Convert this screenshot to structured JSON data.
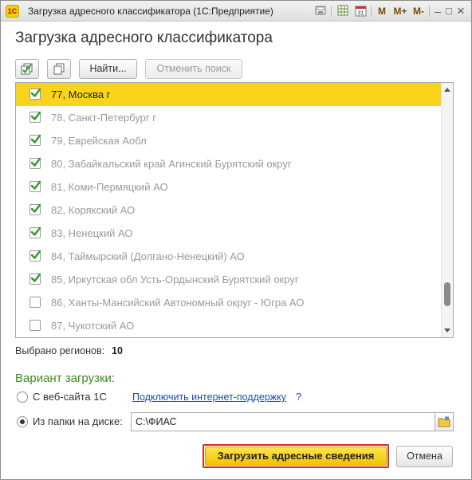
{
  "titlebar": {
    "app_logo": "1C",
    "title": "Загрузка адресного классификатора  (1С:Предприятие)",
    "icons": [
      "save-icon",
      "table-icon",
      "calendar-icon"
    ],
    "calendar_day": "31",
    "m_label": "M",
    "m_plus_label": "M+",
    "m_minus_label": "M-",
    "minimize_glyph": "–",
    "maximize_glyph": "□",
    "close_glyph": "×"
  },
  "form": {
    "title": "Загрузка адресного классификатора"
  },
  "toolbar": {
    "check_all_icon": "check-all-icon",
    "copy_icon": "copy-icon",
    "find_label": "Найти...",
    "cancel_search_label": "Отменить поиск"
  },
  "regions": [
    {
      "label": "77, Москва г",
      "checked": true,
      "selected": true
    },
    {
      "label": "78, Санкт-Петербург г",
      "checked": true,
      "selected": false
    },
    {
      "label": "79, Еврейская Аобл",
      "checked": true,
      "selected": false
    },
    {
      "label": "80, Забайкальский край Агинский Бурятский округ",
      "checked": true,
      "selected": false
    },
    {
      "label": "81, Коми-Пермяцкий АО",
      "checked": true,
      "selected": false
    },
    {
      "label": "82, Корякский АО",
      "checked": true,
      "selected": false
    },
    {
      "label": "83, Ненецкий АО",
      "checked": true,
      "selected": false
    },
    {
      "label": "84, Таймырский (Долгано-Ненецкий) АО",
      "checked": true,
      "selected": false
    },
    {
      "label": "85, Иркутская обл Усть-Ордынский Бурятский округ",
      "checked": true,
      "selected": false
    },
    {
      "label": "86, Ханты-Мансийский Автономный округ - Югра АО",
      "checked": false,
      "selected": false
    },
    {
      "label": "87, Чукотский АО",
      "checked": false,
      "selected": false
    }
  ],
  "summary": {
    "selected_label": "Выбрано регионов:",
    "selected_count": "10"
  },
  "variant": {
    "title": "Вариант загрузки:",
    "option_web_label": "С веб-сайта 1С",
    "option_web_selected": false,
    "connect_link": "Подключить интернет-поддержку",
    "help_glyph": "?",
    "option_folder_label": "Из папки на диске:",
    "option_folder_selected": true,
    "folder_path": "C:\\ФИАС"
  },
  "footer": {
    "load_label": "Загрузить адресные сведения",
    "cancel_label": "Отмена"
  },
  "colors": {
    "selected_row": "#f9d41b",
    "checkmark": "#2e9a2e",
    "section_title": "#3d8a1f",
    "link": "#1f4ea8",
    "primary_button": "#f6cf1a",
    "primary_button_border": "#d62b2b"
  }
}
